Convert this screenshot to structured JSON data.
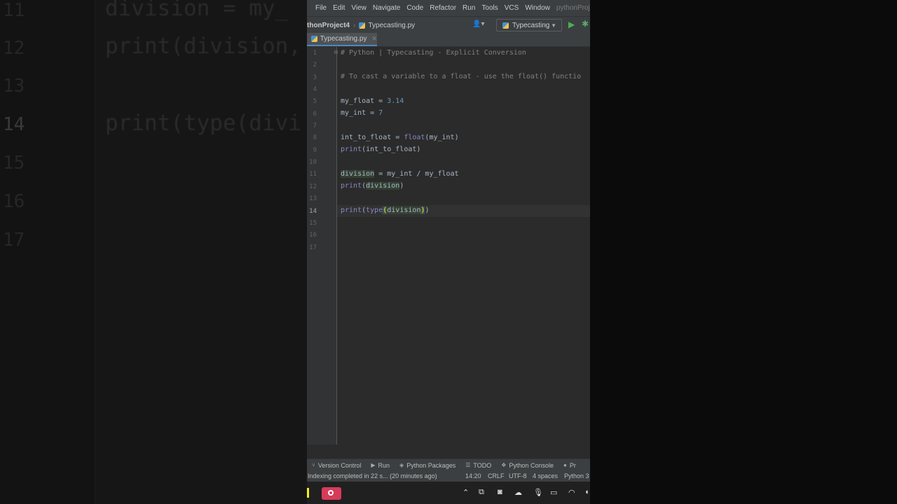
{
  "background": {
    "line_numbers": [
      "11",
      "12",
      "13",
      "14",
      "15",
      "16",
      "17"
    ],
    "lines": [
      "division = my_",
      "print(division,",
      "print(type(divi"
    ]
  },
  "menubar": {
    "items": [
      "File",
      "Edit",
      "View",
      "Navigate",
      "Code",
      "Refactor",
      "Run",
      "Tools",
      "VCS",
      "Window"
    ],
    "project": "pythonProje"
  },
  "navbar": {
    "project": "thonProject4",
    "file": "Typecasting.py",
    "run_config": "Typecasting"
  },
  "tab": {
    "label": "Typecasting.py"
  },
  "editor": {
    "current_line": "14",
    "line_numbers": [
      "1",
      "2",
      "3",
      "4",
      "5",
      "6",
      "7",
      "8",
      "9",
      "10",
      "11",
      "12",
      "13",
      "14",
      "15",
      "16",
      "17"
    ],
    "lines": {
      "l1": "# Python | Typecasting - Explicit Conversion",
      "l3": "# To cast a variable to a float - use the float() functio",
      "l5_var": "my_float = ",
      "l5_num": "3.14",
      "l6_var": "my_int = ",
      "l6_num": "7",
      "l8_a": "int_to_float = ",
      "l8_fn": "float",
      "l8_b": "(my_int)",
      "l9_fn": "print",
      "l9_b": "(int_to_float)",
      "l11_var": "division",
      "l11_b": " = my_int / my_float",
      "l12_fn": "print",
      "l12_a": "(",
      "l12_var": "division",
      "l12_b": ")",
      "l14_fn": "print",
      "l14_a": "(",
      "l14_fn2": "type",
      "l14_br1": "(",
      "l14_var": "division",
      "l14_br2": ")",
      "l14_b": ")"
    }
  },
  "tool_windows": [
    "Version Control",
    "Run",
    "Python Packages",
    "TODO",
    "Python Console",
    "Pr"
  ],
  "status": {
    "message": "Indexing completed in 22 s... (20 minutes ago)",
    "position": "14:20",
    "line_sep": "CRLF",
    "encoding": "UTF-8",
    "indent": "4 spaces",
    "interpreter": "Python 3"
  },
  "icons": {
    "run": "run-icon",
    "debug": "debug-icon",
    "record": "record-icon"
  },
  "colors": {
    "accent_yellow": "#f5ec1f",
    "record_red": "#d63c5a",
    "run_green": "#4caf50"
  }
}
